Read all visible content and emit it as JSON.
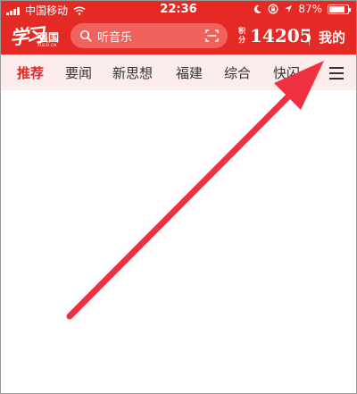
{
  "status_bar": {
    "carrier": "中国移动",
    "time": "22:36",
    "battery": "87%",
    "battery_level": 0.87
  },
  "header": {
    "logo_script": "学习",
    "logo_name": "强国",
    "logo_sub": "XUEXI.CN",
    "search_placeholder": "听音乐",
    "points_label": "积分",
    "points_value": "14205",
    "profile_label": "我的"
  },
  "tabs": [
    {
      "label": "推荐",
      "active": true
    },
    {
      "label": "要闻",
      "active": false
    },
    {
      "label": "新思想",
      "active": false
    },
    {
      "label": "福建",
      "active": false
    },
    {
      "label": "综合",
      "active": false
    },
    {
      "label": "快闪",
      "active": false
    }
  ],
  "icons": {
    "search": "search-icon",
    "scan": "scan-icon",
    "menu": "menu-icon",
    "wifi": "wifi-icon",
    "lock": "rotation-lock-icon",
    "location": "location-arrow-icon",
    "battery": "battery-icon"
  },
  "colors": {
    "brand": "#e52a26",
    "tab_bg": "#fdecec",
    "arrow": "#ef3042"
  }
}
